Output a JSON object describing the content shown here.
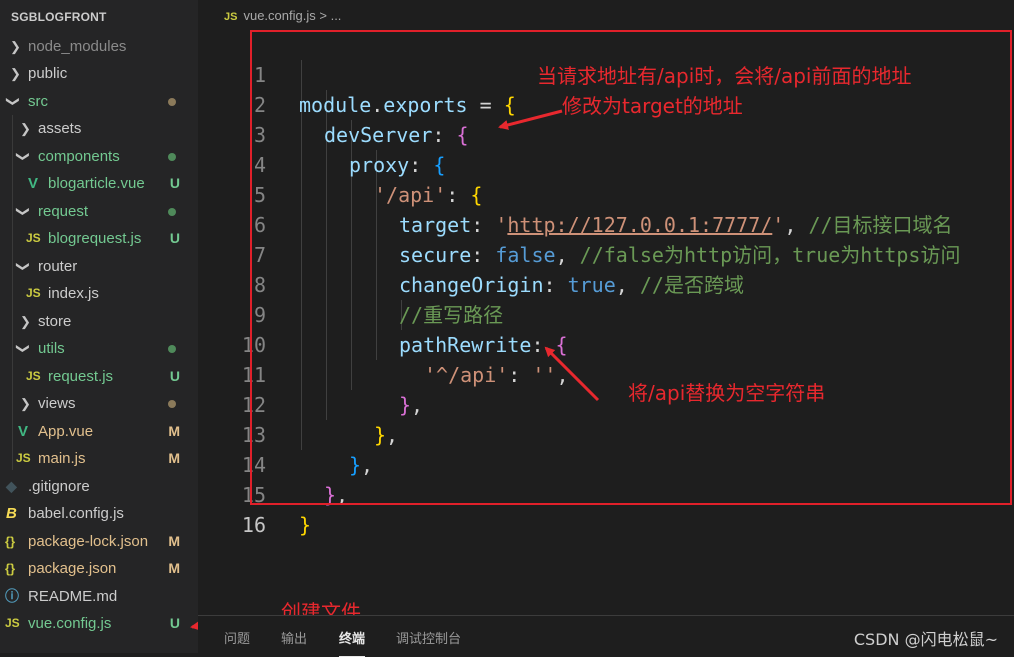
{
  "explorer": {
    "title": "SGBLOGFRONT",
    "items": [
      {
        "label": "node_modules",
        "type": "folder",
        "state": "collapsed",
        "color": "#8b8b8b"
      },
      {
        "label": "public",
        "type": "folder",
        "state": "collapsed",
        "color": "#cccccc"
      },
      {
        "label": "src",
        "type": "folder",
        "state": "expanded",
        "color": "#73c991",
        "dot": "#8b7a5a"
      },
      {
        "label": "assets",
        "type": "folder",
        "state": "collapsed",
        "color": "#cccccc"
      },
      {
        "label": "components",
        "type": "folder",
        "state": "expanded",
        "color": "#73c991",
        "dot": "#5a8a5a"
      },
      {
        "label": "blogarticle.vue",
        "type": "vue",
        "badge": "U",
        "color": "#73c991"
      },
      {
        "label": "request",
        "type": "folder",
        "state": "expanded",
        "color": "#73c991",
        "dot": "#5a8a5a"
      },
      {
        "label": "blogrequest.js",
        "type": "js",
        "badge": "U",
        "color": "#73c991"
      },
      {
        "label": "router",
        "type": "folder",
        "state": "expanded",
        "color": "#cccccc"
      },
      {
        "label": "index.js",
        "type": "js",
        "color": "#cccccc"
      },
      {
        "label": "store",
        "type": "folder",
        "state": "collapsed",
        "color": "#cccccc"
      },
      {
        "label": "utils",
        "type": "folder",
        "state": "expanded",
        "color": "#73c991",
        "dot": "#5a8a5a"
      },
      {
        "label": "request.js",
        "type": "js",
        "badge": "U",
        "color": "#73c991"
      },
      {
        "label": "views",
        "type": "folder",
        "state": "collapsed",
        "color": "#cccccc",
        "dot": "#8b7a5a"
      },
      {
        "label": "App.vue",
        "type": "vue",
        "badge": "M",
        "color": "#e2c08d"
      },
      {
        "label": "main.js",
        "type": "js",
        "badge": "M",
        "color": "#e2c08d"
      },
      {
        "label": ".gitignore",
        "type": "git",
        "color": "#cccccc"
      },
      {
        "label": "babel.config.js",
        "type": "babel",
        "color": "#cccccc"
      },
      {
        "label": "package-lock.json",
        "type": "json",
        "badge": "M",
        "color": "#e2c08d"
      },
      {
        "label": "package.json",
        "type": "json",
        "badge": "M",
        "color": "#e2c08d"
      },
      {
        "label": "README.md",
        "type": "info",
        "color": "#cccccc"
      },
      {
        "label": "vue.config.js",
        "type": "js",
        "badge": "U",
        "color": "#73c991"
      }
    ]
  },
  "editor": {
    "breadcrumb": {
      "icon": "JS",
      "file": "vue.config.js",
      "sep": ">",
      "rest": "..."
    },
    "line_numbers": [
      "1",
      "2",
      "3",
      "4",
      "5",
      "6",
      "7",
      "8",
      "9",
      "10",
      "11",
      "12",
      "13",
      "14",
      "15",
      "16"
    ],
    "code": {
      "l1_a": "module",
      "l1_b": ".",
      "l1_c": "exports",
      "l1_d": " = ",
      "l1_e": "{",
      "l2_a": "devServer",
      "l2_b": ": ",
      "l2_c": "{",
      "l3_a": "proxy",
      "l3_b": ": ",
      "l3_c": "{",
      "l4_a": "'/api'",
      "l4_b": ": ",
      "l4_c": "{",
      "l5_a": "target",
      "l5_b": ": ",
      "l5_c": "'",
      "l5_d": "http://127.0.0.1:7777/",
      "l5_e": "'",
      "l5_f": ", ",
      "l5_g": "//目标接口域名",
      "l6_a": "secure",
      "l6_b": ": ",
      "l6_c": "false",
      "l6_d": ", ",
      "l6_e": "//false为http访问，true为https访问",
      "l7_a": "changeOrigin",
      "l7_b": ": ",
      "l7_c": "true",
      "l7_d": ", ",
      "l7_e": "//是否跨域",
      "l8_a": "//重写路径",
      "l9_a": "pathRewrite",
      "l9_b": ": ",
      "l9_c": "{",
      "l10_a": "'^/api'",
      "l10_b": ": ",
      "l10_c": "''",
      "l10_d": ",",
      "l11_a": "}",
      "l11_b": ",",
      "l12_a": "}",
      "l12_b": ",",
      "l13_a": "}",
      "l13_b": ",",
      "l14_a": "}",
      "l14_b": ",",
      "l15_a": "}"
    }
  },
  "annotations": {
    "top_1": "当请求地址有/api时，会将/api前面的地址",
    "top_2": "修改为target的地址",
    "middle": "将/api替换为空字符串",
    "bottom": "创建文件"
  },
  "panel": {
    "tabs": [
      "问题",
      "输出",
      "终端",
      "调试控制台"
    ],
    "active_tab": "终端"
  },
  "watermark": "CSDN @闪电松鼠~",
  "colors": {
    "annotation_red": "#e8282e",
    "untracked_green": "#73c991",
    "modified_yellow": "#e2c08d"
  }
}
